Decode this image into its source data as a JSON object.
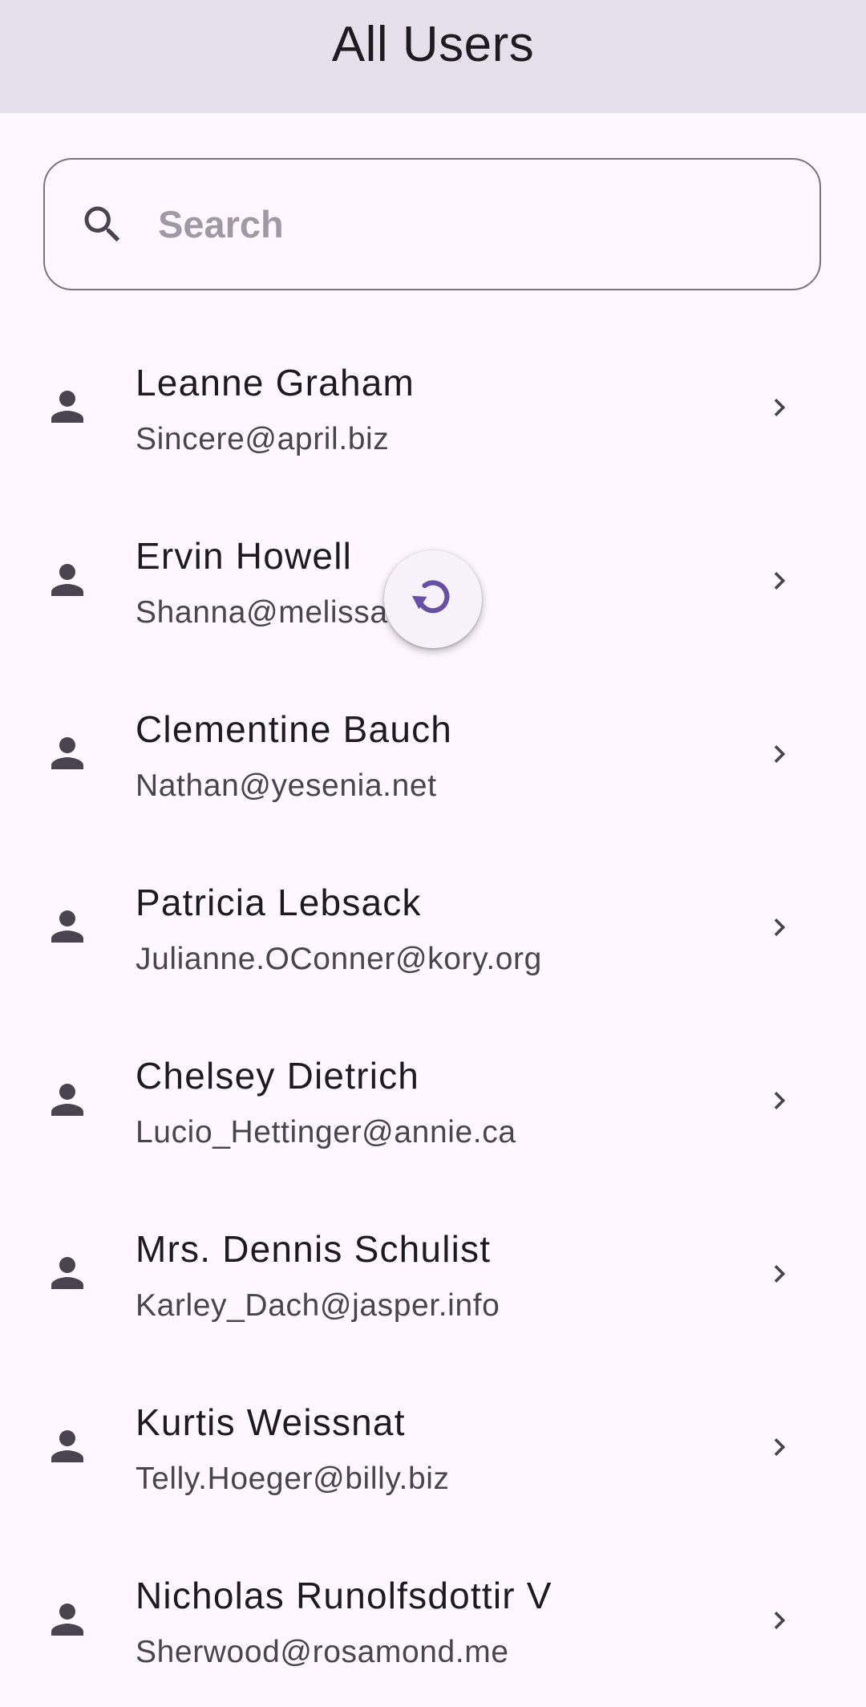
{
  "app_bar": {
    "title": "All Users"
  },
  "search": {
    "placeholder": "Search",
    "value": "",
    "icon": "search-icon"
  },
  "users": [
    {
      "name": "Leanne Graham",
      "email": "Sincere@april.biz"
    },
    {
      "name": "Ervin Howell",
      "email": "Shanna@melissa.tv"
    },
    {
      "name": "Clementine Bauch",
      "email": "Nathan@yesenia.net"
    },
    {
      "name": "Patricia Lebsack",
      "email": "Julianne.OConner@kory.org"
    },
    {
      "name": "Chelsey Dietrich",
      "email": "Lucio_Hettinger@annie.ca"
    },
    {
      "name": "Mrs. Dennis Schulist",
      "email": "Karley_Dach@jasper.info"
    },
    {
      "name": "Kurtis Weissnat",
      "email": "Telly.Hoeger@billy.biz"
    },
    {
      "name": "Nicholas Runolfsdottir V",
      "email": "Sherwood@rosamond.me"
    }
  ],
  "row_icons": {
    "leading": "person-icon",
    "trailing": "chevron-right-icon"
  },
  "refresh_indicator": {
    "icon": "refresh-icon"
  },
  "colors": {
    "app_bar_bg": "#e6e0ea",
    "page_bg": "#fef7ff",
    "accent": "#6750a4",
    "text_primary": "#1d1b20",
    "text_secondary": "#49454f",
    "outline": "#79747e"
  }
}
